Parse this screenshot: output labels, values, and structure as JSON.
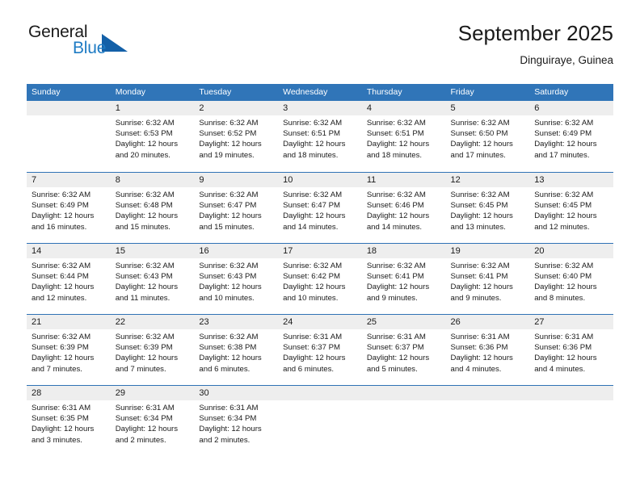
{
  "brand": {
    "name_part1": "General",
    "name_part2": "Blue",
    "accent_color": "#1e7bc4",
    "logo_triangle_color": "#1360a8"
  },
  "header": {
    "title": "September 2025",
    "subtitle": "Dinguiraye, Guinea"
  },
  "theme": {
    "header_row_color": "#3075b8",
    "day_number_band_color": "#eeeeee",
    "week_separator_color": "#2f72b5"
  },
  "weekday_headers": [
    "Sunday",
    "Monday",
    "Tuesday",
    "Wednesday",
    "Thursday",
    "Friday",
    "Saturday"
  ],
  "labels": {
    "sunrise_prefix": "Sunrise:",
    "sunset_prefix": "Sunset:",
    "daylight_prefix": "Daylight:"
  },
  "weeks": [
    [
      {
        "day": "",
        "sunrise": "",
        "sunset": "",
        "daylight": ""
      },
      {
        "day": "1",
        "sunrise": "Sunrise: 6:32 AM",
        "sunset": "Sunset: 6:53 PM",
        "daylight": "Daylight: 12 hours and 20 minutes."
      },
      {
        "day": "2",
        "sunrise": "Sunrise: 6:32 AM",
        "sunset": "Sunset: 6:52 PM",
        "daylight": "Daylight: 12 hours and 19 minutes."
      },
      {
        "day": "3",
        "sunrise": "Sunrise: 6:32 AM",
        "sunset": "Sunset: 6:51 PM",
        "daylight": "Daylight: 12 hours and 18 minutes."
      },
      {
        "day": "4",
        "sunrise": "Sunrise: 6:32 AM",
        "sunset": "Sunset: 6:51 PM",
        "daylight": "Daylight: 12 hours and 18 minutes."
      },
      {
        "day": "5",
        "sunrise": "Sunrise: 6:32 AM",
        "sunset": "Sunset: 6:50 PM",
        "daylight": "Daylight: 12 hours and 17 minutes."
      },
      {
        "day": "6",
        "sunrise": "Sunrise: 6:32 AM",
        "sunset": "Sunset: 6:49 PM",
        "daylight": "Daylight: 12 hours and 17 minutes."
      }
    ],
    [
      {
        "day": "7",
        "sunrise": "Sunrise: 6:32 AM",
        "sunset": "Sunset: 6:49 PM",
        "daylight": "Daylight: 12 hours and 16 minutes."
      },
      {
        "day": "8",
        "sunrise": "Sunrise: 6:32 AM",
        "sunset": "Sunset: 6:48 PM",
        "daylight": "Daylight: 12 hours and 15 minutes."
      },
      {
        "day": "9",
        "sunrise": "Sunrise: 6:32 AM",
        "sunset": "Sunset: 6:47 PM",
        "daylight": "Daylight: 12 hours and 15 minutes."
      },
      {
        "day": "10",
        "sunrise": "Sunrise: 6:32 AM",
        "sunset": "Sunset: 6:47 PM",
        "daylight": "Daylight: 12 hours and 14 minutes."
      },
      {
        "day": "11",
        "sunrise": "Sunrise: 6:32 AM",
        "sunset": "Sunset: 6:46 PM",
        "daylight": "Daylight: 12 hours and 14 minutes."
      },
      {
        "day": "12",
        "sunrise": "Sunrise: 6:32 AM",
        "sunset": "Sunset: 6:45 PM",
        "daylight": "Daylight: 12 hours and 13 minutes."
      },
      {
        "day": "13",
        "sunrise": "Sunrise: 6:32 AM",
        "sunset": "Sunset: 6:45 PM",
        "daylight": "Daylight: 12 hours and 12 minutes."
      }
    ],
    [
      {
        "day": "14",
        "sunrise": "Sunrise: 6:32 AM",
        "sunset": "Sunset: 6:44 PM",
        "daylight": "Daylight: 12 hours and 12 minutes."
      },
      {
        "day": "15",
        "sunrise": "Sunrise: 6:32 AM",
        "sunset": "Sunset: 6:43 PM",
        "daylight": "Daylight: 12 hours and 11 minutes."
      },
      {
        "day": "16",
        "sunrise": "Sunrise: 6:32 AM",
        "sunset": "Sunset: 6:43 PM",
        "daylight": "Daylight: 12 hours and 10 minutes."
      },
      {
        "day": "17",
        "sunrise": "Sunrise: 6:32 AM",
        "sunset": "Sunset: 6:42 PM",
        "daylight": "Daylight: 12 hours and 10 minutes."
      },
      {
        "day": "18",
        "sunrise": "Sunrise: 6:32 AM",
        "sunset": "Sunset: 6:41 PM",
        "daylight": "Daylight: 12 hours and 9 minutes."
      },
      {
        "day": "19",
        "sunrise": "Sunrise: 6:32 AM",
        "sunset": "Sunset: 6:41 PM",
        "daylight": "Daylight: 12 hours and 9 minutes."
      },
      {
        "day": "20",
        "sunrise": "Sunrise: 6:32 AM",
        "sunset": "Sunset: 6:40 PM",
        "daylight": "Daylight: 12 hours and 8 minutes."
      }
    ],
    [
      {
        "day": "21",
        "sunrise": "Sunrise: 6:32 AM",
        "sunset": "Sunset: 6:39 PM",
        "daylight": "Daylight: 12 hours and 7 minutes."
      },
      {
        "day": "22",
        "sunrise": "Sunrise: 6:32 AM",
        "sunset": "Sunset: 6:39 PM",
        "daylight": "Daylight: 12 hours and 7 minutes."
      },
      {
        "day": "23",
        "sunrise": "Sunrise: 6:32 AM",
        "sunset": "Sunset: 6:38 PM",
        "daylight": "Daylight: 12 hours and 6 minutes."
      },
      {
        "day": "24",
        "sunrise": "Sunrise: 6:31 AM",
        "sunset": "Sunset: 6:37 PM",
        "daylight": "Daylight: 12 hours and 6 minutes."
      },
      {
        "day": "25",
        "sunrise": "Sunrise: 6:31 AM",
        "sunset": "Sunset: 6:37 PM",
        "daylight": "Daylight: 12 hours and 5 minutes."
      },
      {
        "day": "26",
        "sunrise": "Sunrise: 6:31 AM",
        "sunset": "Sunset: 6:36 PM",
        "daylight": "Daylight: 12 hours and 4 minutes."
      },
      {
        "day": "27",
        "sunrise": "Sunrise: 6:31 AM",
        "sunset": "Sunset: 6:36 PM",
        "daylight": "Daylight: 12 hours and 4 minutes."
      }
    ],
    [
      {
        "day": "28",
        "sunrise": "Sunrise: 6:31 AM",
        "sunset": "Sunset: 6:35 PM",
        "daylight": "Daylight: 12 hours and 3 minutes."
      },
      {
        "day": "29",
        "sunrise": "Sunrise: 6:31 AM",
        "sunset": "Sunset: 6:34 PM",
        "daylight": "Daylight: 12 hours and 2 minutes."
      },
      {
        "day": "30",
        "sunrise": "Sunrise: 6:31 AM",
        "sunset": "Sunset: 6:34 PM",
        "daylight": "Daylight: 12 hours and 2 minutes."
      },
      {
        "day": "",
        "sunrise": "",
        "sunset": "",
        "daylight": ""
      },
      {
        "day": "",
        "sunrise": "",
        "sunset": "",
        "daylight": ""
      },
      {
        "day": "",
        "sunrise": "",
        "sunset": "",
        "daylight": ""
      },
      {
        "day": "",
        "sunrise": "",
        "sunset": "",
        "daylight": ""
      }
    ]
  ]
}
